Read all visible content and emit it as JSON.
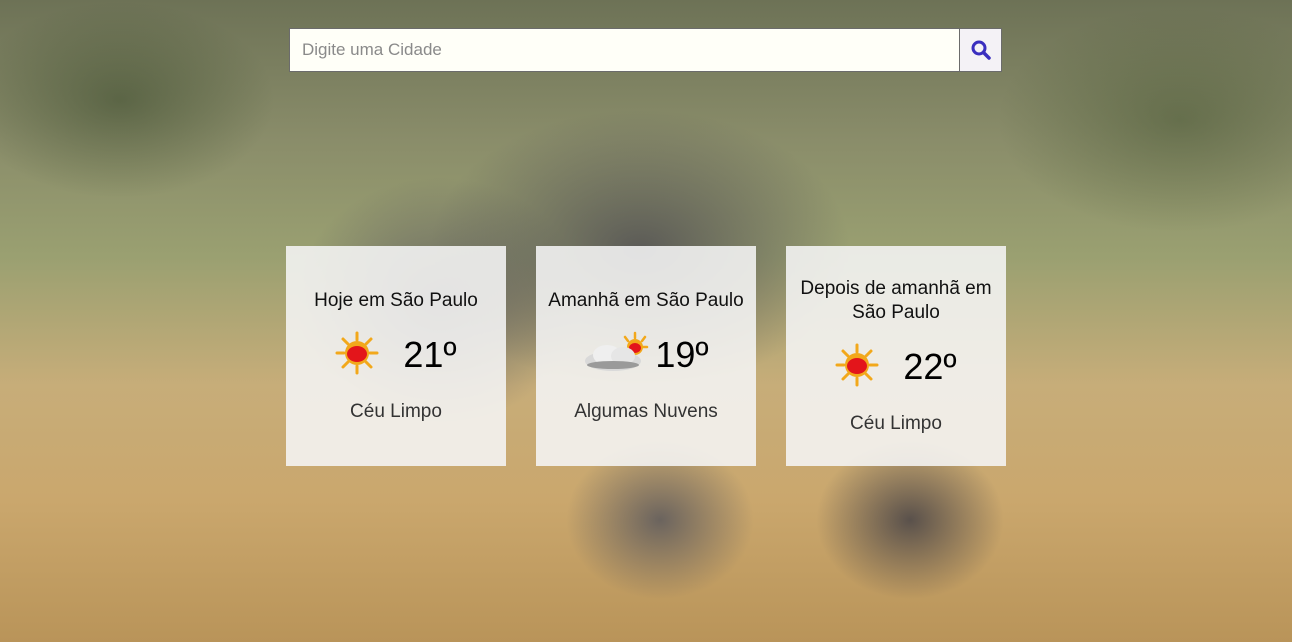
{
  "search": {
    "placeholder": "Digite uma Cidade",
    "value": "",
    "button_icon": "search-icon"
  },
  "colors": {
    "accent": "#3a2fbf",
    "sun": "#f2a81b",
    "sun_core": "#e3151b",
    "card_bg": "#f5f5f5"
  },
  "forecast": [
    {
      "title": "Hoje em São Paulo",
      "temp": "21º",
      "condition": "Céu Limpo",
      "icon": "sun-icon"
    },
    {
      "title": "Amanhã em São Paulo",
      "temp": "19º",
      "condition": "Algumas Nuvens",
      "icon": "partly-cloudy-icon"
    },
    {
      "title": "Depois de amanhã em São Paulo",
      "temp": "22º",
      "condition": "Céu Limpo",
      "icon": "sun-icon"
    }
  ]
}
